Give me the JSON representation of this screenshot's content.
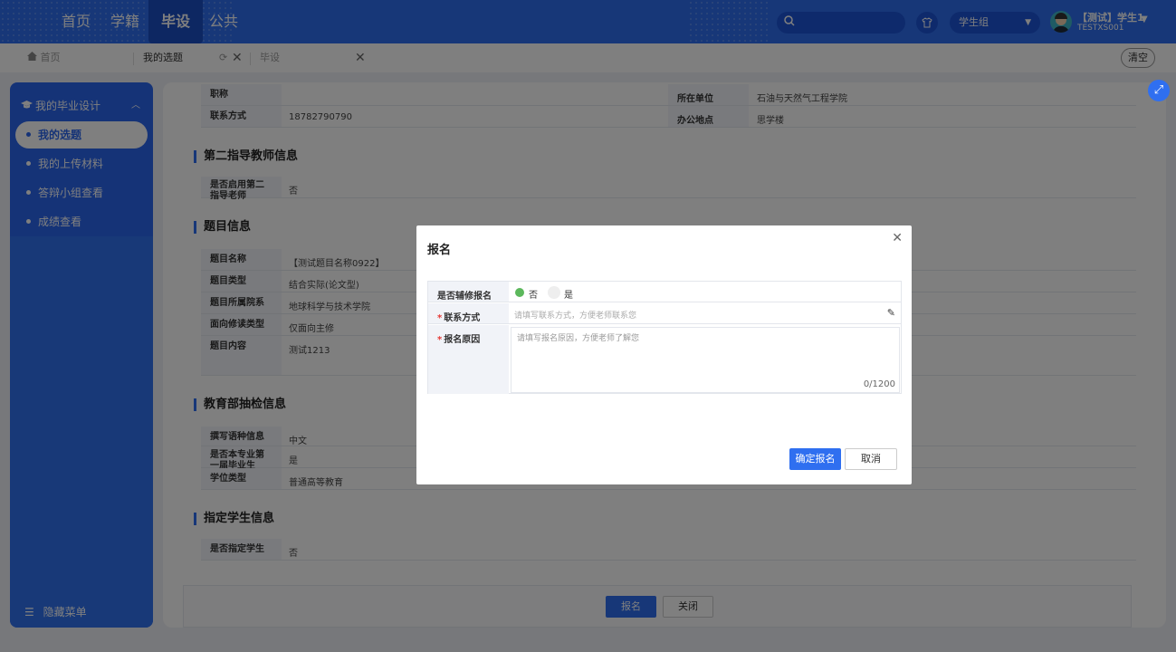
{
  "topnav": {
    "items": [
      "首页",
      "学籍",
      "毕设",
      "公共"
    ],
    "active_index": 2,
    "role_select": "学生组",
    "user_name": "【测试】学生1",
    "user_id": "TESTXS001"
  },
  "tabs": {
    "home": "首页",
    "items": [
      {
        "label": "我的选题",
        "active": true
      },
      {
        "label": "毕设",
        "active": false
      }
    ],
    "clear": "清空"
  },
  "sidebar": {
    "group": "我的毕业设计",
    "items": [
      "我的选题",
      "我的上传材料",
      "答辩小组查看",
      "成绩查看"
    ],
    "active_index": 0,
    "footer": "隐藏菜单"
  },
  "main": {
    "teacher_rows": [
      {
        "k": "职称",
        "v": "",
        "k2": "所在单位",
        "v2": "石油与天然气工程学院"
      },
      {
        "k": "联系方式",
        "v": "18782790790",
        "k2": "办公地点",
        "v2": "思学楼"
      }
    ],
    "second_teacher": {
      "title": "第二指导教师信息",
      "rows": [
        {
          "k": "是否启用第二指导老师",
          "v": "否"
        }
      ]
    },
    "topic": {
      "title": "题目信息",
      "rows": [
        {
          "k": "题目名称",
          "v": "【测试题目名称0922】"
        },
        {
          "k": "题目类型",
          "v": "结合实际(论文型)"
        },
        {
          "k": "题目所属院系",
          "v": "地球科学与技术学院"
        },
        {
          "k": "面向修读类型",
          "v": "仅面向主修"
        },
        {
          "k": "题目内容",
          "v": "测试1213"
        }
      ]
    },
    "ministry": {
      "title": "教育部抽检信息",
      "rows": [
        {
          "k": "撰写语种信息",
          "v": "中文"
        },
        {
          "k": "是否本专业第一届毕业生",
          "v": "是"
        },
        {
          "k": "学位类型",
          "v": "普通高等教育"
        }
      ]
    },
    "assigned": {
      "title": "指定学生信息",
      "rows": [
        {
          "k": "是否指定学生",
          "v": "否"
        }
      ]
    },
    "buttons": {
      "signup": "报名",
      "close": "关闭"
    }
  },
  "modal": {
    "title": "报名",
    "minor_label": "是否辅修报名",
    "minor_options": [
      "否",
      "是"
    ],
    "minor_selected": "否",
    "contact_label": "联系方式",
    "contact_placeholder": "请填写联系方式，方便老师联系您",
    "reason_label": "报名原因",
    "reason_placeholder": "请填写报名原因，方便老师了解您",
    "reason_counter": "0/1200",
    "confirm": "确定报名",
    "cancel": "取消",
    "required_mark": "*"
  },
  "icons": {
    "search": "search-icon",
    "shirt": "shirt-icon",
    "home": "home-icon",
    "expand": "expand-icon"
  },
  "colors": {
    "primary": "#2f6ff0",
    "success": "#5cb85c",
    "required": "#e53935"
  }
}
